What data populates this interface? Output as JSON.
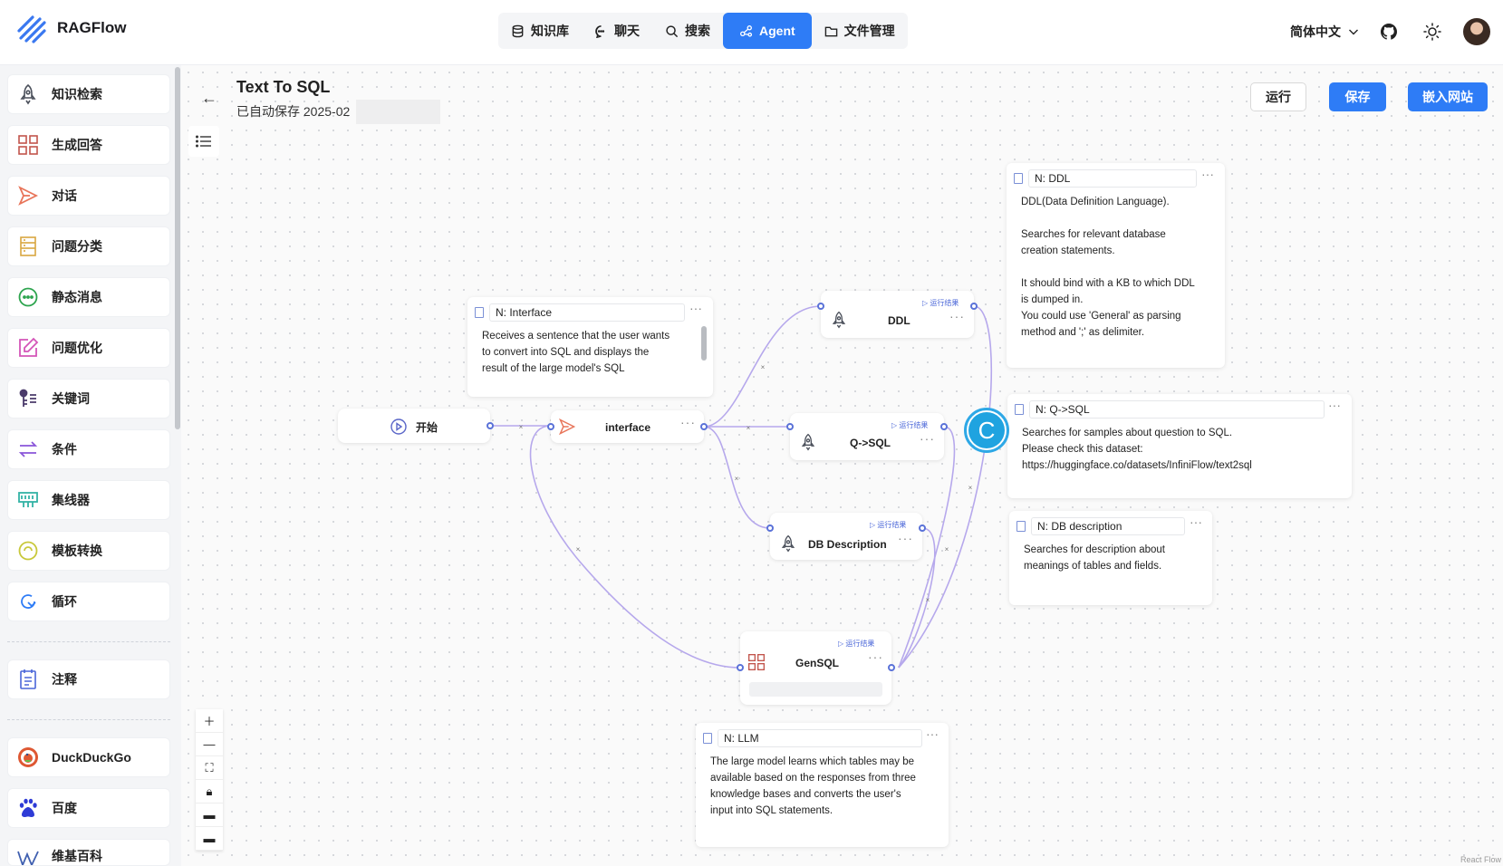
{
  "app": {
    "name": "RAGFlow"
  },
  "nav": {
    "items": [
      {
        "label": "知识库",
        "icon": "database-icon"
      },
      {
        "label": "聊天",
        "icon": "chat-icon"
      },
      {
        "label": "搜索",
        "icon": "search-icon"
      },
      {
        "label": "Agent",
        "icon": "agent-icon",
        "active": true
      },
      {
        "label": "文件管理",
        "icon": "folder-icon"
      }
    ],
    "language": "简体中文"
  },
  "sidebar": {
    "items": [
      {
        "label": "知识检索",
        "icon": "rocket-icon",
        "color": "#4a4f5a"
      },
      {
        "label": "生成回答",
        "icon": "generate-icon",
        "color": "#c2554c"
      },
      {
        "label": "对话",
        "icon": "send-icon",
        "color": "#e8755a"
      },
      {
        "label": "问题分类",
        "icon": "category-icon",
        "color": "#d9a640"
      },
      {
        "label": "静态消息",
        "icon": "message-icon",
        "color": "#2da44e"
      },
      {
        "label": "问题优化",
        "icon": "edit-icon",
        "color": "#d455b8"
      },
      {
        "label": "关键词",
        "icon": "keyword-icon",
        "color": "#4b3b6b"
      },
      {
        "label": "条件",
        "icon": "switch-icon",
        "color": "#8a55d9"
      },
      {
        "label": "集线器",
        "icon": "hub-icon",
        "color": "#33b3a5"
      },
      {
        "label": "模板转换",
        "icon": "template-icon",
        "color": "#d6d64a"
      },
      {
        "label": "循环",
        "icon": "loop-icon",
        "color": "#2e7cf6"
      },
      {
        "label": "注释",
        "icon": "note-icon",
        "color": "#4a66d8"
      },
      {
        "label": "DuckDuckGo",
        "icon": "duckduckgo-icon",
        "color": "#de5833"
      },
      {
        "label": "百度",
        "icon": "baidu-icon",
        "color": "#2e3bd6"
      },
      {
        "label": "维基百科",
        "icon": "wikipedia-icon",
        "color": "#4060b0"
      }
    ]
  },
  "flow": {
    "title": "Text To SQL",
    "saved_text": "已自动保存 2025-02",
    "buttons": {
      "run": "运行",
      "save": "保存",
      "embed": "嵌入网站"
    },
    "run_result_label": "运行结果",
    "nodes": {
      "begin": "开始",
      "interface": "interface",
      "ddl": "DDL",
      "qsql": "Q->SQL",
      "dbdesc": "DB Description",
      "gensql": "GenSQL"
    },
    "notes": {
      "interface": {
        "name": "N: Interface",
        "body": "Receives a sentence that the user wants\nto convert into SQL and displays the\nresult of the large model's SQL"
      },
      "ddl": {
        "name": "N: DDL",
        "body": "DDL(Data Definition Language).\n\nSearches for relevant database\ncreation statements.\n\nIt should bind with a KB to which DDL\nis dumped in.\nYou could use  'General' as parsing\nmethod and ';' as delimiter."
      },
      "qsql": {
        "name": "N: Q->SQL",
        "body": "Searches for samples about question to SQL.\nPlease check this dataset:\nhttps://huggingface.co/datasets/InfiniFlow/text2sql"
      },
      "dbdesc": {
        "name": "N: DB description",
        "body": "Searches for description about\nmeanings of  tables and fields."
      },
      "llm": {
        "name": "N: LLM",
        "body": "The large model learns which tables may be\navailable based on the responses from three\nknowledge bases and converts the user's\ninput into SQL statements."
      }
    },
    "spinner_letter": "C",
    "attribution": "React Flow"
  }
}
